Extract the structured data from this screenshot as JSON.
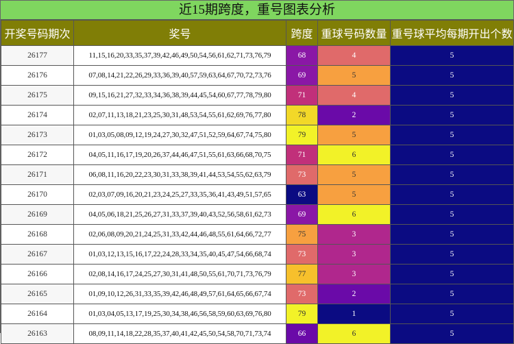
{
  "title": "近15期跨度，重号图表分析",
  "headers": [
    "开奖号码期次",
    "奖号",
    "跨度",
    "重球号码数量",
    "重号球平均每期开出个数"
  ],
  "colors": {
    "header_bg": "#807e06",
    "title_bg": "#7fd65f",
    "navy": "#0b0b82",
    "purple": "#6a0aa8",
    "magenta": "#b0278d",
    "salmon": "#e06a6a",
    "orange": "#f7a040",
    "yellow": "#f2f228"
  },
  "rows": [
    {
      "period": "26177",
      "numbers": "11,15,16,20,33,35,37,39,42,46,49,50,54,56,61,62,71,73,76,79",
      "span": "68",
      "span_color": "#8a17a6",
      "repeat": "4",
      "repeat_color": "#e06a6a",
      "avg": "5"
    },
    {
      "period": "26176",
      "numbers": "07,08,14,21,22,26,29,33,36,39,40,57,59,63,64,67,70,72,73,76",
      "span": "69",
      "span_color": "#8a17a6",
      "repeat": "5",
      "repeat_color": "#f7a040",
      "avg": "5"
    },
    {
      "period": "26175",
      "numbers": "09,15,16,21,27,32,33,34,36,38,39,44,45,54,60,67,77,78,79,80",
      "span": "71",
      "span_color": "#c1307a",
      "repeat": "4",
      "repeat_color": "#e06a6a",
      "avg": "5"
    },
    {
      "period": "26174",
      "numbers": "02,07,11,13,18,21,23,25,30,31,48,53,54,55,61,62,69,76,77,80",
      "span": "78",
      "span_color": "#f2d828",
      "repeat": "2",
      "repeat_color": "#6a0aa8",
      "avg": "5"
    },
    {
      "period": "26173",
      "numbers": "01,03,05,08,09,12,19,24,27,30,32,47,51,52,59,64,67,74,75,80",
      "span": "79",
      "span_color": "#f2f228",
      "repeat": "5",
      "repeat_color": "#f7a040",
      "avg": "5"
    },
    {
      "period": "26172",
      "numbers": "04,05,11,16,17,19,20,26,37,44,46,47,51,55,61,63,66,68,70,75",
      "span": "71",
      "span_color": "#c1307a",
      "repeat": "6",
      "repeat_color": "#f2f228",
      "avg": "5"
    },
    {
      "period": "26171",
      "numbers": "06,08,11,16,20,22,23,30,31,33,38,39,41,44,53,54,55,62,63,79",
      "span": "73",
      "span_color": "#e06a6a",
      "repeat": "5",
      "repeat_color": "#f7a040",
      "avg": "5"
    },
    {
      "period": "26170",
      "numbers": "02,03,07,09,16,20,21,23,24,25,27,33,35,36,41,43,49,51,57,65",
      "span": "63",
      "span_color": "#0b0b82",
      "repeat": "5",
      "repeat_color": "#f7a040",
      "avg": "5"
    },
    {
      "period": "26169",
      "numbers": "04,05,06,18,21,25,26,27,31,33,37,39,40,43,52,56,58,61,62,73",
      "span": "69",
      "span_color": "#8a17a6",
      "repeat": "6",
      "repeat_color": "#f2f228",
      "avg": "5"
    },
    {
      "period": "26168",
      "numbers": "02,06,08,09,20,21,24,25,31,33,42,44,46,48,55,61,64,66,72,77",
      "span": "75",
      "span_color": "#f7a040",
      "repeat": "3",
      "repeat_color": "#b0278d",
      "avg": "5"
    },
    {
      "period": "26167",
      "numbers": "01,03,12,13,15,16,17,22,24,28,33,34,35,40,45,47,54,66,68,74",
      "span": "73",
      "span_color": "#e06a6a",
      "repeat": "3",
      "repeat_color": "#b0278d",
      "avg": "5"
    },
    {
      "period": "26166",
      "numbers": "02,08,14,16,17,24,25,27,30,31,41,48,50,55,61,70,71,73,76,79",
      "span": "77",
      "span_color": "#f7c02c",
      "repeat": "3",
      "repeat_color": "#b0278d",
      "avg": "5"
    },
    {
      "period": "26165",
      "numbers": "01,09,10,12,26,31,33,35,39,42,46,48,49,57,61,64,65,66,67,74",
      "span": "73",
      "span_color": "#e06a6a",
      "repeat": "2",
      "repeat_color": "#6a0aa8",
      "avg": "5"
    },
    {
      "period": "26164",
      "numbers": "01,03,04,05,13,17,19,25,30,34,38,46,56,58,59,60,63,69,76,80",
      "span": "79",
      "span_color": "#f2f228",
      "repeat": "1",
      "repeat_color": "#0b0b82",
      "avg": "5"
    },
    {
      "period": "26163",
      "numbers": "08,09,11,14,18,22,28,35,37,40,41,42,45,50,54,58,70,71,73,74",
      "span": "66",
      "span_color": "#6a0aa8",
      "repeat": "6",
      "repeat_color": "#f2f228",
      "avg": "5"
    }
  ]
}
